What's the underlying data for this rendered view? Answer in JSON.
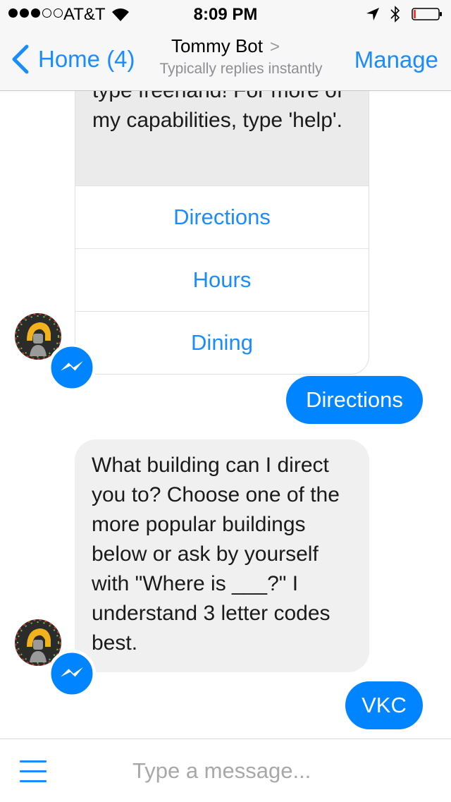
{
  "status_bar": {
    "carrier": "AT&T",
    "time": "8:09 PM",
    "signal_bars_filled": 3,
    "signal_bars_total": 5
  },
  "nav": {
    "back_label": "Home (4)",
    "title": "Tommy Bot",
    "title_chevron": ">",
    "subtitle": "Typically replies instantly",
    "manage_label": "Manage"
  },
  "messages": {
    "card_text": "type freehand! For more of my capabilities, type 'help'.",
    "card_buttons": [
      "Directions",
      "Hours",
      "Dining"
    ],
    "user_msg_1": "Directions",
    "bot_msg_2": "What building can I direct you to? Choose one of the more popular buildings below or ask by yourself with \"Where is ___?\" I understand 3 letter codes best.",
    "user_msg_2": "VKC"
  },
  "composer": {
    "placeholder": "Type a message..."
  },
  "colors": {
    "accent": "#1a8cff",
    "outgoing_bubble": "#0084ff",
    "incoming_bubble": "#f1f0f0",
    "card_header": "#ebebeb"
  },
  "icons": [
    "signal-dots-icon",
    "wifi-icon",
    "location-arrow-icon",
    "bluetooth-icon",
    "battery-icon",
    "back-chevron-icon",
    "bot-avatar-icon",
    "messenger-badge-icon",
    "menu-hamburger-icon"
  ]
}
